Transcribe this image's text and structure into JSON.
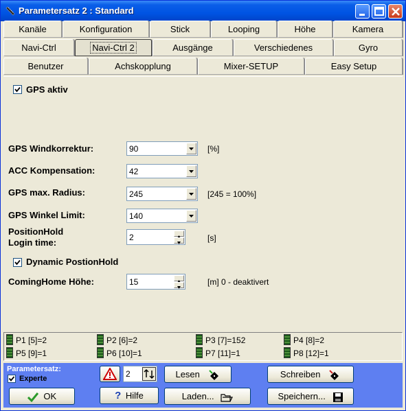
{
  "window": {
    "title": "Parametersatz 2 : Standard"
  },
  "tabs": {
    "row1": [
      "Kanäle",
      "Konfiguration",
      "Stick",
      "Looping",
      "Höhe",
      "Kamera"
    ],
    "row2": [
      "Navi-Ctrl",
      "Navi-Ctrl 2",
      "Ausgänge",
      "Verschiedenes",
      "Gyro"
    ],
    "row3": [
      "Benutzer",
      "Achskopplung",
      "Mixer-SETUP",
      "Easy Setup"
    ],
    "active": "Navi-Ctrl 2"
  },
  "form": {
    "gps_active": {
      "label": "GPS aktiv",
      "checked": true
    },
    "wind": {
      "label": "GPS Windkorrektur:",
      "value": "90",
      "unit": "[%]"
    },
    "acc": {
      "label": "ACC Kompensation:",
      "value": "42"
    },
    "radius": {
      "label": "GPS max. Radius:",
      "value": "245",
      "unit": "[245 = 100%]"
    },
    "winkel": {
      "label": "GPS Winkel Limit:",
      "value": "140"
    },
    "poshold": {
      "label1": "PositionHold",
      "label2": "Login time:",
      "value": "2",
      "unit": "[s]"
    },
    "dynamic": {
      "label": "Dynamic PostionHold",
      "checked": true
    },
    "cominghome": {
      "label": "ComingHome Höhe:",
      "value": "15",
      "unit": "[m]  0 - deaktivert"
    }
  },
  "params": [
    "P1 [5]=2",
    "P2 [6]=2",
    "P3 [7]=152",
    "P4 [8]=2",
    "P5 [9]=1",
    "P6 [10]=1",
    "P7 [11]=1",
    "P8 [12]=1"
  ],
  "footer": {
    "set_label": "Parametersatz:",
    "experte": "Experte",
    "experte_checked": true,
    "set_number": "2",
    "ok": "OK",
    "hilfe": "Hilfe",
    "lesen": "Lesen",
    "laden": "Laden...",
    "schreiben": "Schreiben",
    "speichern": "Speichern..."
  },
  "colors": {
    "titlebar": "#0054e3",
    "footer": "#5e7ff1",
    "window": "#ece9d8"
  }
}
